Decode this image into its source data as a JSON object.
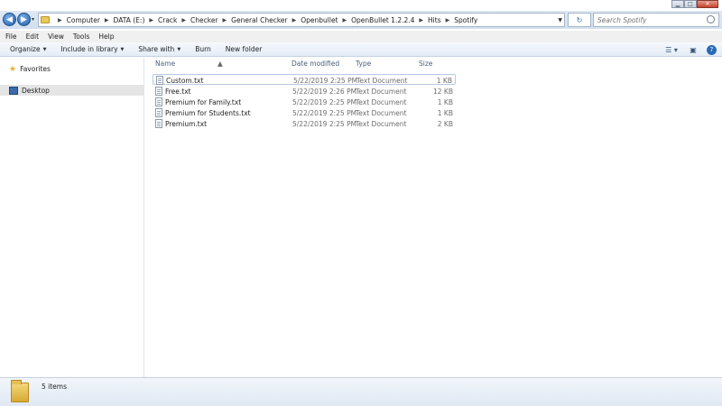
{
  "window_controls": {
    "minimize": "▁",
    "maximize": "□",
    "close": "✕"
  },
  "nav": {
    "back_icon": "◀",
    "forward_icon": "▶",
    "recent_icon": "▾",
    "refresh_icon": "↻"
  },
  "breadcrumb": [
    "Computer",
    "DATA (E:)",
    "Crack",
    "Checker",
    "General Checker",
    "Openbullet",
    "OpenBullet 1.2.2.4",
    "Hits",
    "Spotify"
  ],
  "search": {
    "placeholder": "Search Spotify"
  },
  "menu": [
    "File",
    "Edit",
    "View",
    "Tools",
    "Help"
  ],
  "toolbar": {
    "organize": "Organize",
    "include_in_library": "Include in library",
    "share_with": "Share with",
    "burn": "Burn",
    "new_folder": "New folder"
  },
  "sidebar": {
    "favorites": "Favorites",
    "desktop": "Desktop"
  },
  "columns": {
    "name": "Name",
    "date_modified": "Date modified",
    "type": "Type",
    "size": "Size"
  },
  "files": [
    {
      "name": "Custom.txt",
      "date": "5/22/2019 2:25 PM",
      "type": "Text Document",
      "size": "1 KB"
    },
    {
      "name": "Free.txt",
      "date": "5/22/2019 2:26 PM",
      "type": "Text Document",
      "size": "12 KB"
    },
    {
      "name": "Premium for Family.txt",
      "date": "5/22/2019 2:25 PM",
      "type": "Text Document",
      "size": "1 KB"
    },
    {
      "name": "Premium for Students.txt",
      "date": "5/22/2019 2:25 PM",
      "type": "Text Document",
      "size": "1 KB"
    },
    {
      "name": "Premium.txt",
      "date": "5/22/2019 2:25 PM",
      "type": "Text Document",
      "size": "2 KB"
    }
  ],
  "status": {
    "item_count": "5 items"
  }
}
